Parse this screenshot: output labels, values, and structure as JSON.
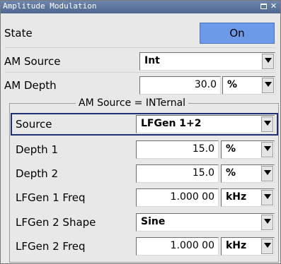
{
  "window": {
    "title": "Amplitude Modulation",
    "icons": [
      "maximize-icon",
      "close-icon"
    ]
  },
  "state": {
    "label": "State",
    "value": "On"
  },
  "am_source": {
    "label": "AM Source",
    "value": "Int"
  },
  "am_depth": {
    "label": "AM Depth",
    "value": "30.0",
    "unit": "%"
  },
  "group": {
    "title": "AM Source = INTernal",
    "source": {
      "label": "Source",
      "value": "LFGen 1+2"
    },
    "depth1": {
      "label": "Depth 1",
      "value": "15.0",
      "unit": "%"
    },
    "depth2": {
      "label": "Depth 2",
      "value": "15.0",
      "unit": "%"
    },
    "lfgen1_freq": {
      "label": "LFGen 1 Freq",
      "value": "1.000 00",
      "unit": "kHz"
    },
    "lfgen2_shape": {
      "label": "LFGen 2 Shape",
      "value": "Sine"
    },
    "lfgen2_freq": {
      "label": "LFGen 2 Freq",
      "value": "1.000 00",
      "unit": "kHz"
    }
  },
  "colors": {
    "titlebar": "#5a729c",
    "on_button": "#6d9ae8",
    "focus_border": "#1e2f73",
    "panel": "#e8e8e8"
  }
}
